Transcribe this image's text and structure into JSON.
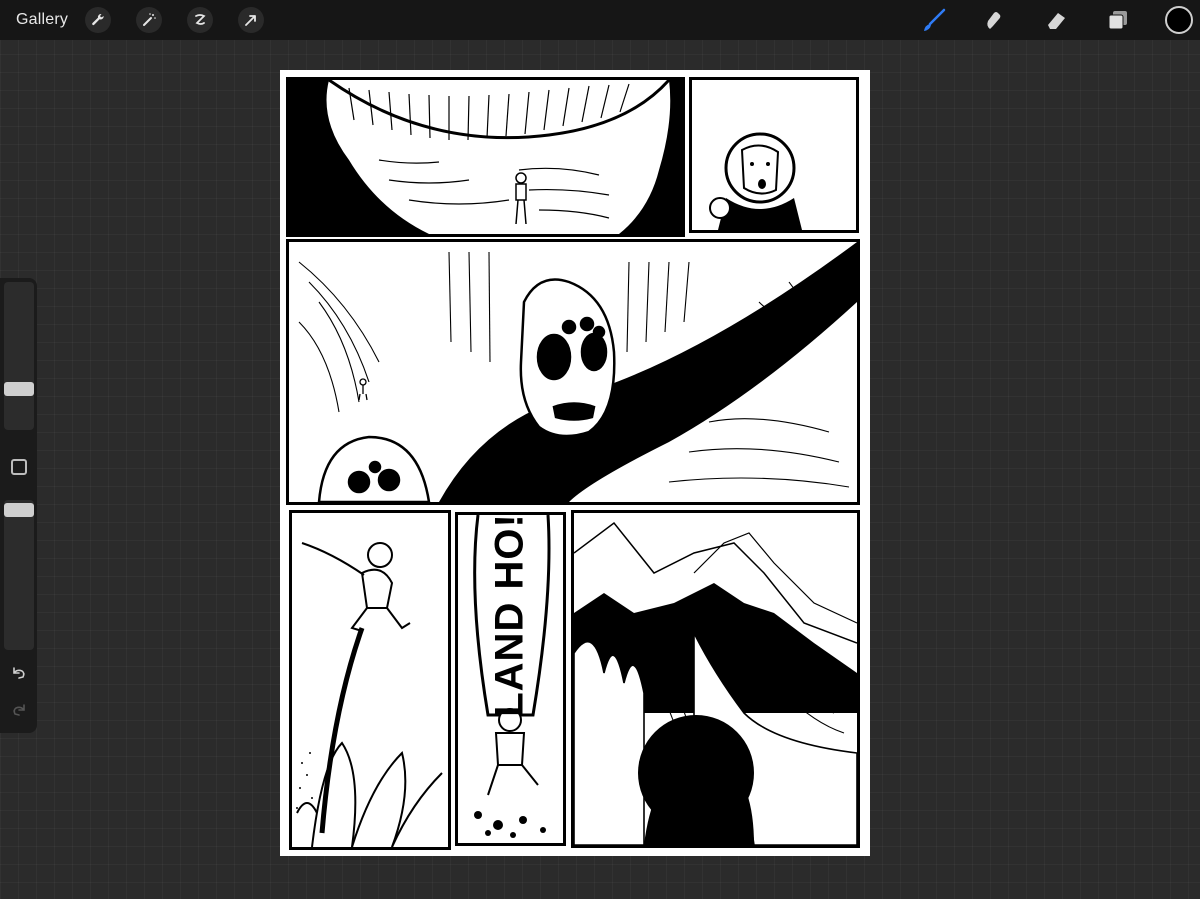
{
  "toolbar": {
    "gallery_label": "Gallery",
    "left_tools": [
      "wrench-icon",
      "magic-wand-icon",
      "selection-icon",
      "transform-arrow-icon"
    ],
    "right_tools": [
      "brush-icon",
      "smudge-icon",
      "eraser-icon",
      "layers-icon"
    ],
    "active_tool": "brush-icon",
    "accent_color": "#2f7cf6",
    "current_color": "#000000"
  },
  "sidebar": {
    "controls": [
      "brush-size-slider",
      "modify-button",
      "opacity-slider",
      "undo-button",
      "redo-button"
    ]
  },
  "canvas": {
    "lettering": "LAND HO!"
  }
}
